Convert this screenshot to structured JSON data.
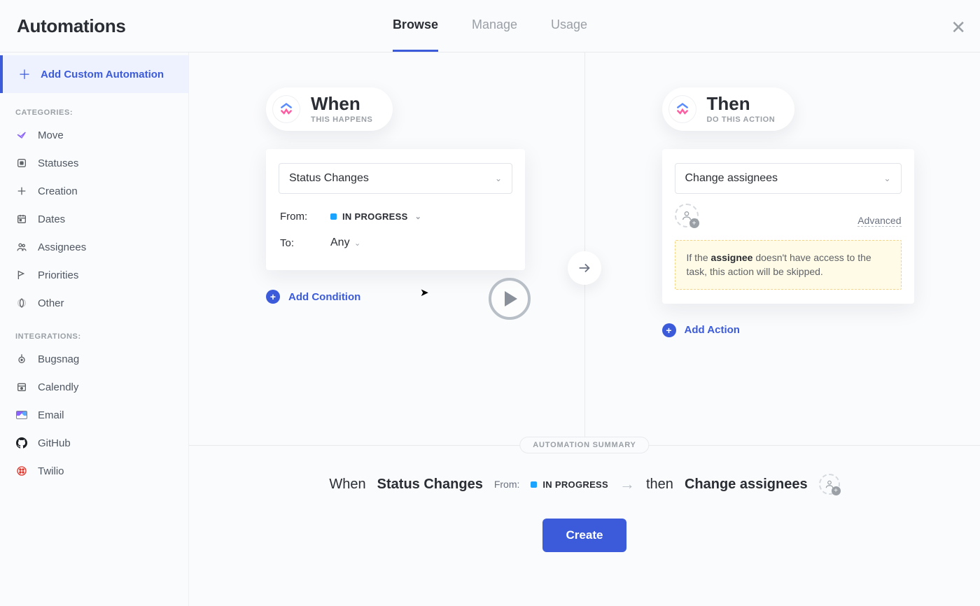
{
  "header": {
    "title": "Automations",
    "tabs": [
      {
        "label": "Browse",
        "active": true
      },
      {
        "label": "Manage",
        "active": false
      },
      {
        "label": "Usage",
        "active": false
      }
    ]
  },
  "sidebar": {
    "add_custom": "Add Custom Automation",
    "categories_label": "CATEGORIES:",
    "categories": [
      {
        "id": "move",
        "label": "Move"
      },
      {
        "id": "statuses",
        "label": "Statuses"
      },
      {
        "id": "creation",
        "label": "Creation"
      },
      {
        "id": "dates",
        "label": "Dates"
      },
      {
        "id": "assignees",
        "label": "Assignees"
      },
      {
        "id": "priorities",
        "label": "Priorities"
      },
      {
        "id": "other",
        "label": "Other"
      }
    ],
    "integrations_label": "INTEGRATIONS:",
    "integrations": [
      {
        "id": "bugsnag",
        "label": "Bugsnag"
      },
      {
        "id": "calendly",
        "label": "Calendly"
      },
      {
        "id": "email",
        "label": "Email"
      },
      {
        "id": "github",
        "label": "GitHub"
      },
      {
        "id": "twilio",
        "label": "Twilio"
      }
    ]
  },
  "builder": {
    "when": {
      "title": "When",
      "subtitle": "THIS HAPPENS",
      "trigger_select": "Status Changes",
      "from_label": "From:",
      "from_value": "IN PROGRESS",
      "to_label": "To:",
      "to_value": "Any",
      "add_condition": "Add Condition"
    },
    "then": {
      "title": "Then",
      "subtitle": "DO THIS ACTION",
      "action_select": "Change assignees",
      "advanced": "Advanced",
      "warning_pre": "If the ",
      "warning_bold": "assignee",
      "warning_post": " doesn't have access to the task, this action will be skipped.",
      "add_action": "Add Action"
    }
  },
  "summary": {
    "badge": "AUTOMATION SUMMARY",
    "when_word": "When",
    "trigger_bold": "Status Changes",
    "from_label": "From:",
    "from_value": "IN PROGRESS",
    "then_word": "then",
    "action_bold": "Change assignees",
    "create_btn": "Create"
  },
  "colors": {
    "accent": "#3b5bdb",
    "status_inprogress": "#1aa3ff"
  }
}
